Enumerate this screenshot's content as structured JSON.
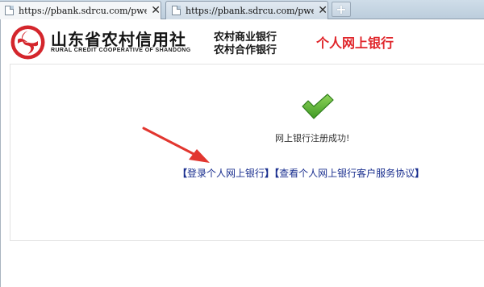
{
  "browser": {
    "tabs": [
      {
        "title": "https://pbank.sdrcu.com/pwe",
        "close_glyph": "✕",
        "active": true
      },
      {
        "title": "https://pbank.sdrcu.com/pwe",
        "close_glyph": "✕",
        "active": false
      }
    ],
    "new_tab_glyph": "+"
  },
  "header": {
    "org_name_cn": "山东省农村信用社",
    "org_name_en": "RURAL CREDIT COOPERATIVE OF SHANDONG",
    "bank_line1": "农村商业银行",
    "bank_line2": "农村合作银行",
    "site_title": "个人网上银行"
  },
  "main": {
    "success_message": "网上银行注册成功!",
    "links": [
      {
        "open": "【",
        "label": "登录个人网上银行",
        "close": "】"
      },
      {
        "open": "【",
        "label": "查看个人网上银行客户服务协议",
        "close": "】"
      }
    ]
  },
  "colors": {
    "logo_red": "#d4262c",
    "title_red": "#e0262b",
    "check_green": "#4caa2e",
    "link_blue": "#1a2f8f",
    "arrow_red": "#e2362f"
  }
}
